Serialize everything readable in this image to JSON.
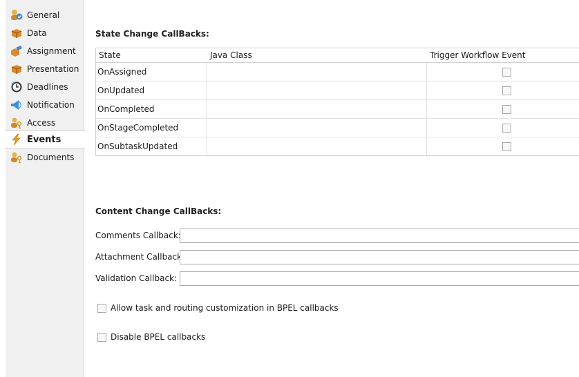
{
  "sidebar": {
    "items": [
      {
        "label": "General",
        "icon": "general-icon"
      },
      {
        "label": "Data",
        "icon": "data-icon"
      },
      {
        "label": "Assignment",
        "icon": "assignment-icon"
      },
      {
        "label": "Presentation",
        "icon": "presentation-icon"
      },
      {
        "label": "Deadlines",
        "icon": "deadlines-icon"
      },
      {
        "label": "Notification",
        "icon": "notification-icon"
      },
      {
        "label": "Access",
        "icon": "access-icon"
      },
      {
        "label": "Events",
        "icon": "events-icon",
        "active": true
      },
      {
        "label": "Documents",
        "icon": "documents-icon"
      }
    ]
  },
  "state_section": {
    "title": "State Change CallBacks:",
    "columns": [
      "State",
      "Java Class",
      "Trigger Workflow Event"
    ],
    "rows": [
      {
        "state": "OnAssigned",
        "java_class": "",
        "trigger": false
      },
      {
        "state": "OnUpdated",
        "java_class": "",
        "trigger": false
      },
      {
        "state": "OnCompleted",
        "java_class": "",
        "trigger": false
      },
      {
        "state": "OnStageCompleted",
        "java_class": "",
        "trigger": false
      },
      {
        "state": "OnSubtaskUpdated",
        "java_class": "",
        "trigger": false
      }
    ]
  },
  "content_section": {
    "title": "Content Change CallBacks:",
    "comments_label": "Comments Callback:",
    "comments_value": "",
    "attachment_label": "Attachment Callback:",
    "attachment_value": "",
    "validation_label": "Validation Callback:",
    "validation_value": ""
  },
  "options": {
    "allow_customization_label": "Allow task and routing customization in BPEL callbacks",
    "allow_customization_checked": false,
    "disable_bpel_label": "Disable BPEL callbacks",
    "disable_bpel_checked": false
  }
}
